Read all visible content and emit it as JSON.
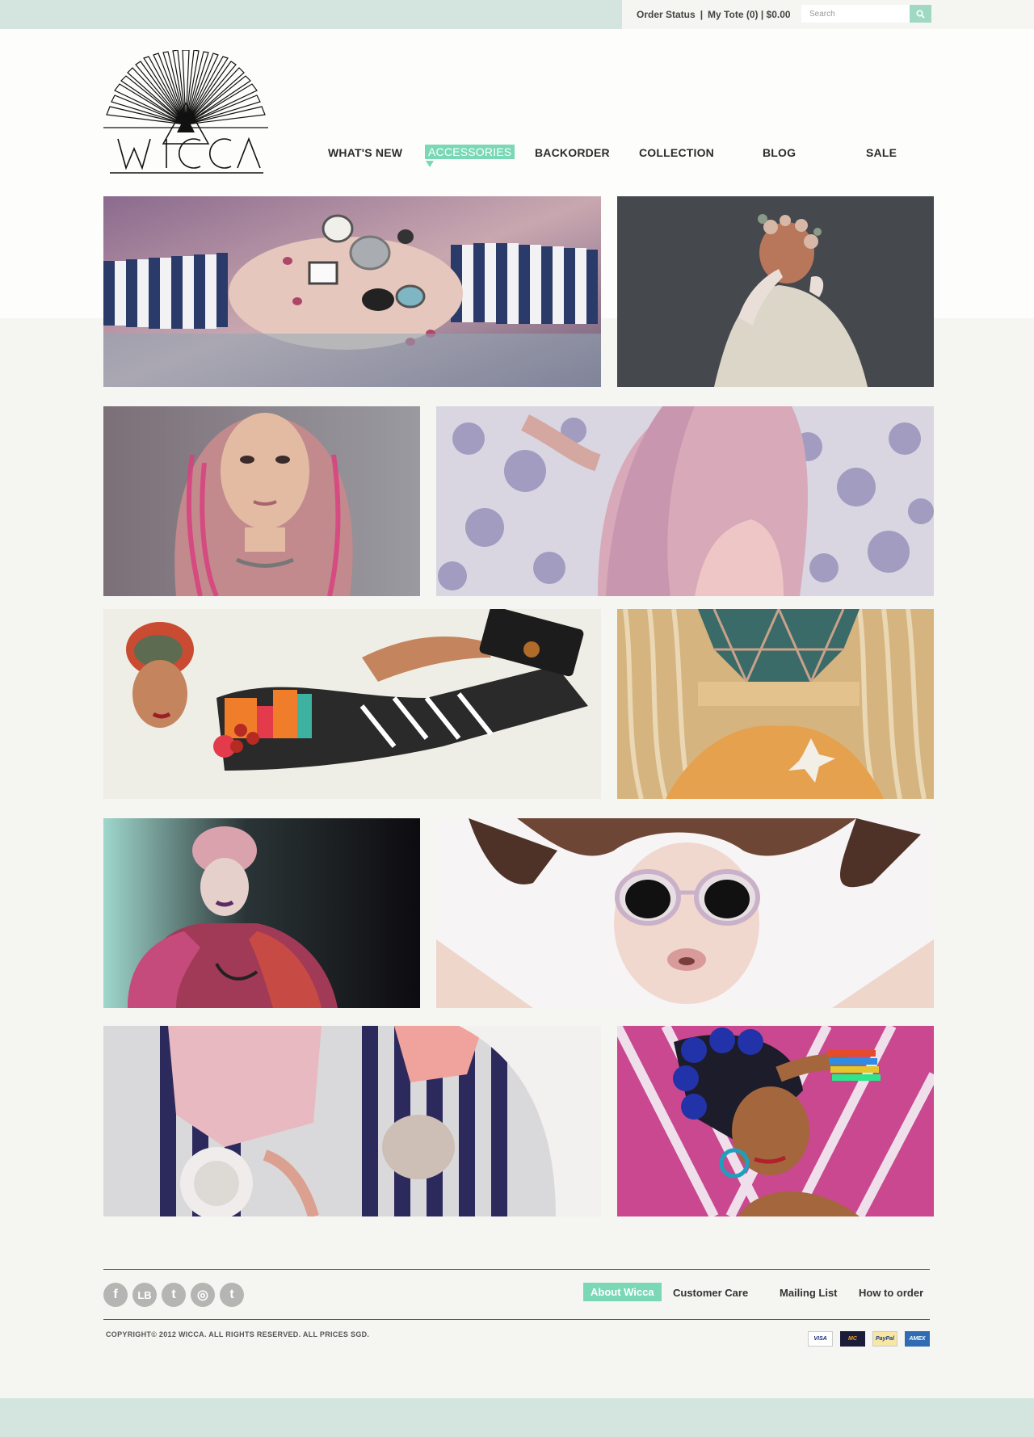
{
  "topbar": {
    "order_status": "Order Status",
    "separator": "|",
    "my_tote": "My Tote (0) | $0.00",
    "search_placeholder": "Search",
    "search_icon": "search-icon"
  },
  "logo": {
    "text": "WICCA"
  },
  "nav": {
    "items": [
      {
        "label": "WHAT'S NEW"
      },
      {
        "label": "ACCESSORIES"
      },
      {
        "label": "BACKORDER"
      },
      {
        "label": "COLLECTION"
      },
      {
        "label": "BLOG"
      },
      {
        "label": "SALE"
      }
    ],
    "active_index": 1
  },
  "gallery": {
    "tiles": [
      {
        "subject": "hands with rings and striped sleeves"
      },
      {
        "subject": "woman with flower crown"
      },
      {
        "subject": "woman with pink hair portrait"
      },
      {
        "subject": "pink hair on floral background"
      },
      {
        "subject": "woman in turban with colorful outfit"
      },
      {
        "subject": "blonde hair with geometric overlay"
      },
      {
        "subject": "woman in pink hat and fur"
      },
      {
        "subject": "woman in clear sunglasses"
      },
      {
        "subject": "two women on striped towels"
      },
      {
        "subject": "woman with hair rollers and bangles"
      }
    ]
  },
  "footer": {
    "social": [
      {
        "icon": "facebook-icon",
        "glyph": "f"
      },
      {
        "icon": "lookbook-icon",
        "glyph": "LB"
      },
      {
        "icon": "tumblr-icon",
        "glyph": "t"
      },
      {
        "icon": "instagram-icon",
        "glyph": "◎"
      },
      {
        "icon": "twitter-icon",
        "glyph": "t"
      }
    ],
    "links": [
      {
        "label": "About Wicca"
      },
      {
        "label": "Customer Care"
      },
      {
        "label": "Mailing List"
      },
      {
        "label": "How to order"
      }
    ],
    "copyright": "COPYRIGHT© 2012 WICCA. ALL RIGHTS RESERVED. ALL PRICES SGD.",
    "payments": [
      {
        "label": "VISA",
        "icon": "visa-icon"
      },
      {
        "label": "MC",
        "icon": "mastercard-icon"
      },
      {
        "label": "PayPal",
        "icon": "paypal-icon"
      },
      {
        "label": "AMEX",
        "icon": "amex-icon"
      }
    ]
  },
  "colors": {
    "accent": "#7ad8b6",
    "bar": "#d3e5de",
    "background": "#f5f5f1"
  }
}
